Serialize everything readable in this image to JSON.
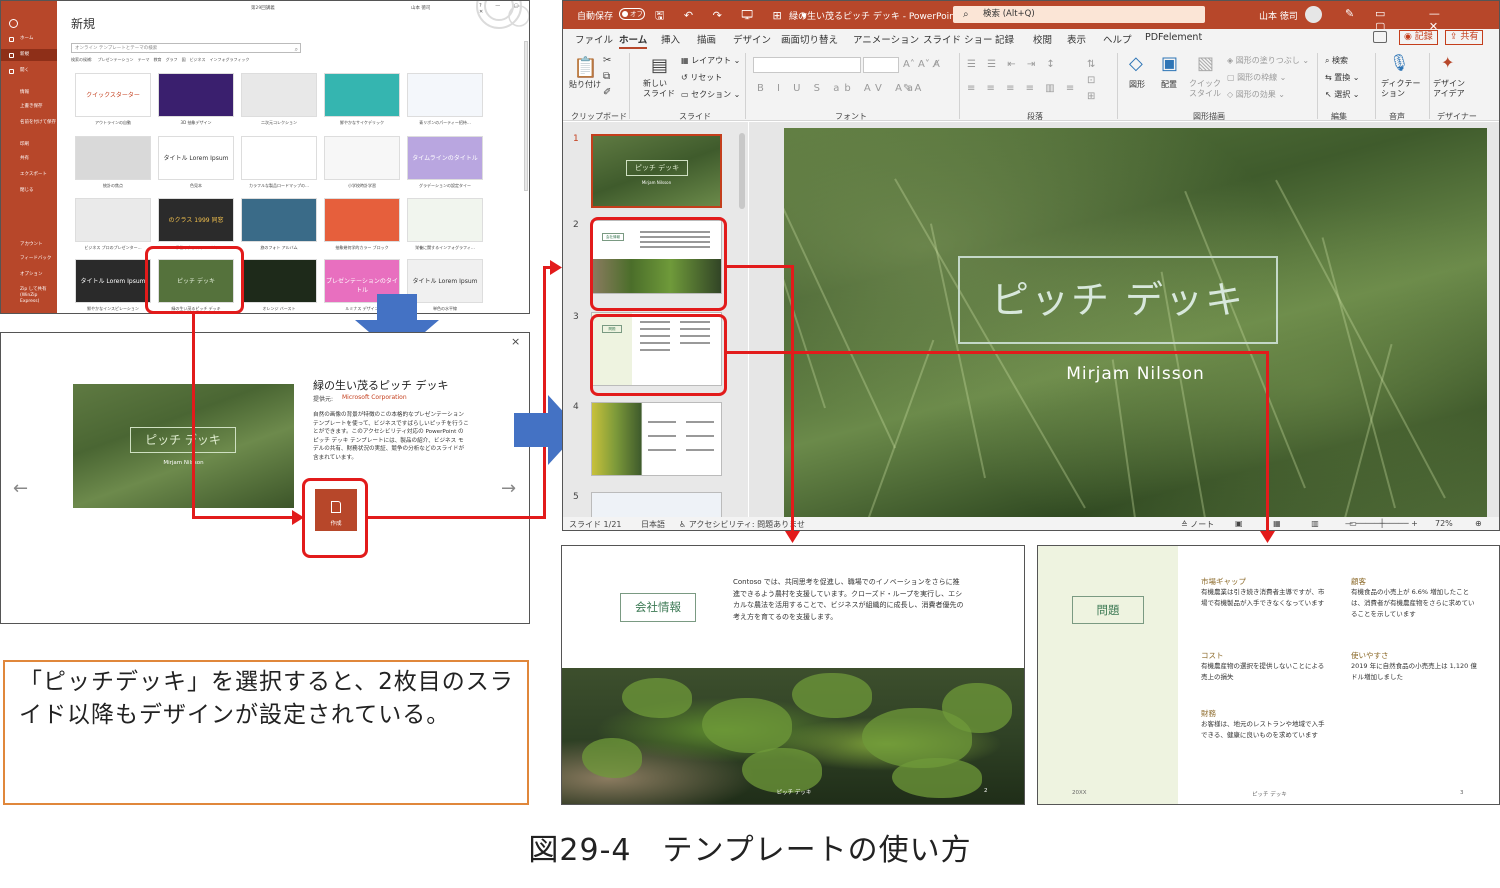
{
  "new_screen": {
    "doc_name": "第29回講義",
    "user": "山本 徳司",
    "title": "新規",
    "search_placeholder": "オンライン テンプレートとテーマの検索",
    "suggest_label": "検索の候補:",
    "suggest_items": [
      "プレゼンテーション",
      "テーマ",
      "教育",
      "グラフ",
      "図",
      "ビジネス",
      "インフォグラフィック"
    ],
    "sidebar": [
      {
        "label": "ホーム",
        "icon": "home-icon"
      },
      {
        "label": "新規",
        "icon": "new-icon"
      },
      {
        "label": "開く",
        "icon": "open-icon"
      },
      {
        "label": "情報",
        "icon": ""
      },
      {
        "label": "上書き保存",
        "icon": ""
      },
      {
        "label": "名前を付けて保存",
        "icon": ""
      },
      {
        "label": "印刷",
        "icon": ""
      },
      {
        "label": "共有",
        "icon": ""
      },
      {
        "label": "エクスポート",
        "icon": ""
      },
      {
        "label": "閉じる",
        "icon": ""
      },
      {
        "label": "アカウント",
        "icon": ""
      },
      {
        "label": "フィードバック",
        "icon": ""
      },
      {
        "label": "オプション",
        "icon": ""
      },
      {
        "label": "Zip して共有 (WinZip Express)",
        "icon": ""
      }
    ],
    "templates": [
      {
        "label": "アウトラインの自動",
        "inner": "クイックスターター",
        "bg": "#ffffff",
        "fg": "#c43e1c"
      },
      {
        "label": "3D 抽象デザイン",
        "inner": "",
        "bg": "#3a1f6e",
        "fg": "#ffffff"
      },
      {
        "label": "二次元コレクション",
        "inner": "",
        "bg": "#e8e8e8",
        "fg": "#333"
      },
      {
        "label": "鮮やかなサイケデリック",
        "inner": "",
        "bg": "#35b5b0",
        "fg": "#fff"
      },
      {
        "label": "青リボンのパーティー招待…",
        "inner": "",
        "bg": "#f4f7fb",
        "fg": "#333"
      },
      {
        "label": "統計の焦点",
        "inner": "",
        "bg": "#d9d9d9",
        "fg": "#333"
      },
      {
        "label": "色見本",
        "inner": "タイトル Lorem Ipsum",
        "bg": "#ffffff",
        "fg": "#333"
      },
      {
        "label": "カラフルな製品ロードマップの…",
        "inner": "",
        "bg": "#ffffff",
        "fg": "#333"
      },
      {
        "label": "小学校時計学習",
        "inner": "",
        "bg": "#f7f7f7",
        "fg": "#333"
      },
      {
        "label": "グラデーションの設定タイー",
        "inner": "タイムラインのタイトル",
        "bg": "#b9a6e0",
        "fg": "#fff"
      },
      {
        "label": "ビジネス プロのプレゼンター…",
        "inner": "",
        "bg": "#eaeaea",
        "fg": "#333"
      },
      {
        "label": "学校のクラス アルバム",
        "inner": "のクラス 1999 同窓",
        "bg": "#2b2b2b",
        "fg": "#f2c14e"
      },
      {
        "label": "旅のフォト アルバム",
        "inner": "",
        "bg": "#3a6b88",
        "fg": "#fff"
      },
      {
        "label": "抽象幾何学的カラー ブロック",
        "inner": "",
        "bg": "#e65f3c",
        "fg": "#fff"
      },
      {
        "label": "栄養に関するインフォグラフィ…",
        "inner": "",
        "bg": "#f1f5ee",
        "fg": "#333"
      },
      {
        "label": "鮮やかなインスピレーション",
        "inner": "タイトル Lorem Ipsum",
        "bg": "#2a2a2a",
        "fg": "#fff"
      },
      {
        "label": "緑の生い茂るピッチ デッキ",
        "inner": "ピッチ デッキ",
        "bg": "#55723c",
        "fg": "#e0ecd6"
      },
      {
        "label": "オレンジ バースト",
        "inner": "",
        "bg": "#1e2a1a",
        "fg": "#fff"
      },
      {
        "label": "ルミナス デザイン",
        "inner": "プレゼンテーションのタイトル",
        "bg": "#e86fbf",
        "fg": "#fff"
      },
      {
        "label": "単色の水平線",
        "inner": "タイトル Lorem Ipsum",
        "bg": "#f0f0f0",
        "fg": "#333"
      }
    ]
  },
  "dialog": {
    "title": "緑の生い茂るピッチ デッキ",
    "provider_label": "提供元:",
    "provider": "Microsoft Corporation",
    "description": "自然の画像の背景が特徴のこの本格的なプレゼンテーション テンプレートを使って、ビジネスですばらしいピッチを行うことができます。このアクセシビリティ対応の PowerPoint のピッチ デッキ テンプレートには、製品の紹介、ビジネス モデルの共有、財務状況の実証、競争の分析などのスライドが含まれています。",
    "thumb_title": "ピッチ デッキ",
    "thumb_sub": "Mirjam Nilsson",
    "create_label": "作成",
    "prev_glyph": "←",
    "next_glyph": "→",
    "close_glyph": "×"
  },
  "caption_box": "「ピッチデッキ」を選択すると、2枚目のスライド以降もデザインが設定されている。",
  "ppt": {
    "autosave": "自動保存",
    "autosave_state": "オフ",
    "doc_title": "緑の生い茂るピッチ デッキ  -  PowerPoint",
    "search": "検索 (Alt+Q)",
    "user": "山本 徳司",
    "tabs": [
      "ファイル",
      "ホーム",
      "挿入",
      "描画",
      "デザイン",
      "画面切り替え",
      "アニメーション",
      "スライド ショー",
      "記録",
      "校閲",
      "表示",
      "ヘルプ",
      "PDFelement"
    ],
    "record_label": "記録",
    "share_label": "共有",
    "ribbon": {
      "paste": "貼り付け",
      "new_slide": "新しい\nスライド",
      "layout": "レイアウト",
      "reset": "リセット",
      "section": "セクション",
      "shapes": "図形",
      "arrange": "配置",
      "quick_style": "クイック\nスタイル",
      "shape_fill": "図形の塗りつぶし",
      "shape_outline": "図形の枠線",
      "shape_effect": "図形の効果",
      "find": "検索",
      "replace": "置換",
      "select": "選択",
      "dictate": "ディクテー\nション",
      "designer": "デザイン\nアイデア",
      "groups": [
        "クリップボード",
        "スライド",
        "フォント",
        "段落",
        "図形描画",
        "編集",
        "音声",
        "デザイナー"
      ]
    },
    "slide_numbers": [
      "1",
      "2",
      "3",
      "4",
      "5"
    ],
    "main_title": "ピッチ デッキ",
    "main_sub": "Mirjam Nilsson",
    "status": {
      "slide": "スライド 1/21",
      "lang": "日本語",
      "access": "アクセシビリティ: 問題ありませ",
      "notes": "ノート",
      "zoom": "72%"
    }
  },
  "slide2": {
    "box": "会社情報",
    "text": "Contoso では、共同思考を促進し、職場でのイノベーションをさらに推進できるよう農村を支援しています。クローズド・ループを実行し、エシカルな農法を活用することで、ビジネスが組織的に成長し、消費者優先の考え方を育てるのを支援します。",
    "footer": "ピッチ デッキ",
    "page": "2"
  },
  "slide3": {
    "box": "問題",
    "items": [
      {
        "h": "市場ギャップ",
        "p": "有機農業は引き続き消費者主導ですが、市場で有機製品が入手できなくなっています"
      },
      {
        "h": "顧客",
        "p": "有機食品の小売上が 6.6% 増加したことは、消費者が有機農産物をさらに求めていることを示しています"
      },
      {
        "h": "コスト",
        "p": "有機農産物の選択を提供しないことによる売上の損失"
      },
      {
        "h": "使いやすさ",
        "p": "2019 年に自然食品の小売売上は 1,120 億ドル増加しました"
      },
      {
        "h": "財務",
        "p": "お客様は、地元のレストランや地域で入手できる、健康に良いものを求めています"
      }
    ],
    "year": "20XX",
    "footer": "ピッチ デッキ",
    "page": "3"
  },
  "figure_caption": "図29-4　テンプレートの使い方",
  "colors": {
    "ppt_red": "#b7472a",
    "highlight": "#e21b1b",
    "arrow_blue": "#4472c4",
    "caption_border": "#e0873b"
  }
}
